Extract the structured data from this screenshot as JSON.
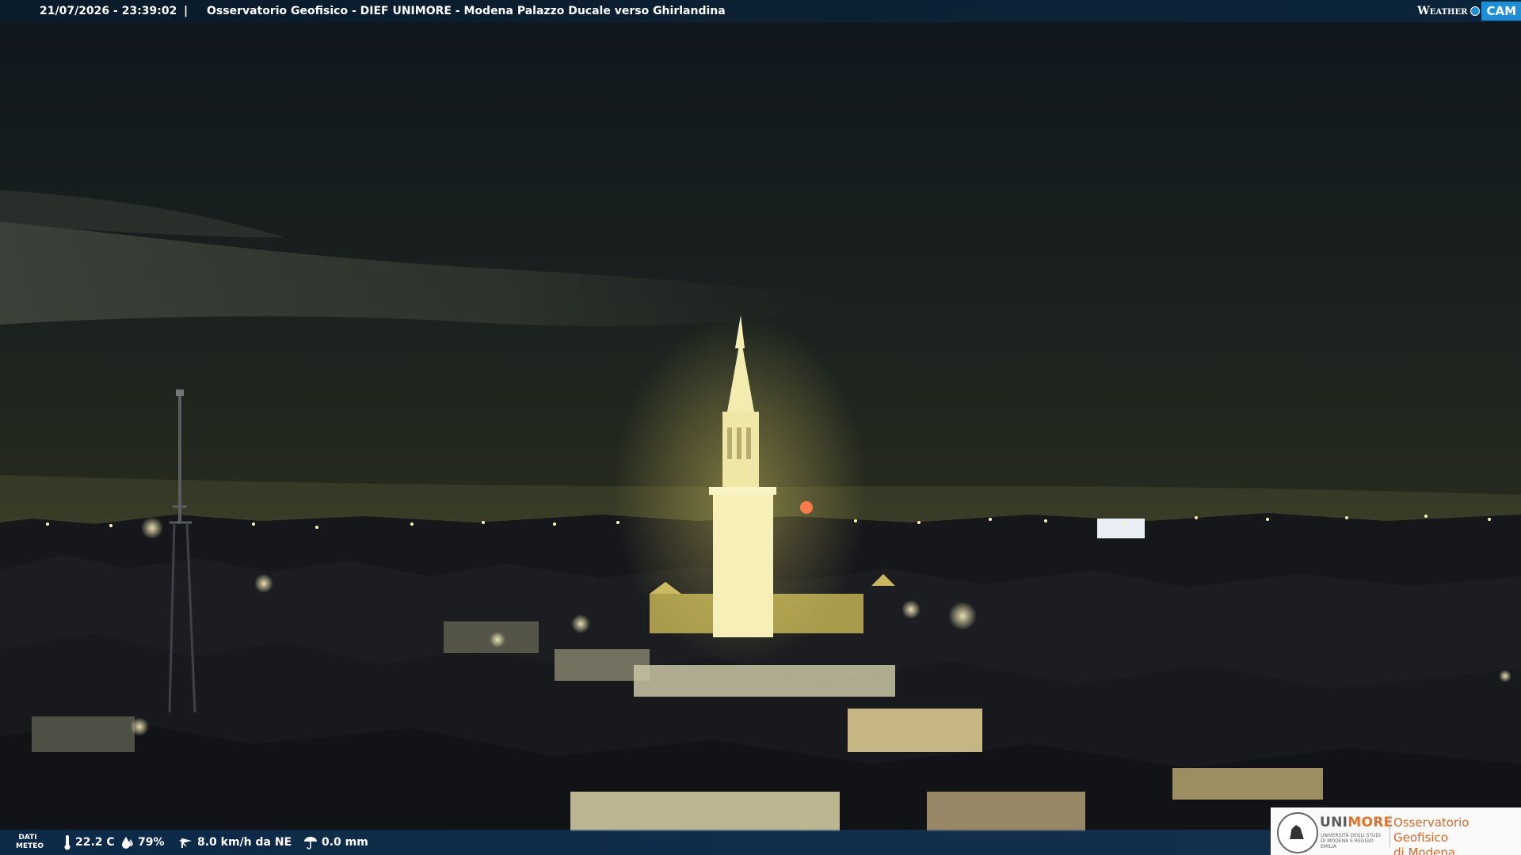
{
  "topbar": {
    "timestamp": "21/07/2026 - 23:39:02",
    "separator": "|",
    "title": "Osservatorio Geofisico - DIEF UNIMORE - Modena Palazzo Ducale verso Ghirlandina",
    "brand_weather": "Weather",
    "brand_cam": "CAM"
  },
  "weather": {
    "label": "DATI METEO",
    "temperature": "22.2 C",
    "humidity": "79%",
    "wind": "8.0 km/h da NE",
    "rain": "0.0 mm",
    "icons": [
      "thermometer-icon",
      "humidity-drop-icon",
      "wind-icon",
      "rain-gauge-icon"
    ]
  },
  "logo": {
    "university": "UNI",
    "university_accent": "MORE",
    "university_sub": "UNIVERSITÀ DEGLI STUDI DI MODENA E REGGIO EMILIA",
    "observatory_line1": "Osservatorio Geofisico",
    "observatory_line2": "di Modena"
  },
  "colors": {
    "accent_blue": "#1d8fd6",
    "logo_orange": "#e2722a",
    "tower_light": "#f6f0b8"
  }
}
